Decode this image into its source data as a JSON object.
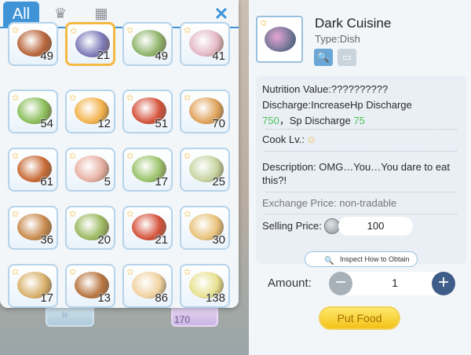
{
  "tabs": {
    "active_label": "All",
    "icons": [
      "chef-hat-icon",
      "grid-icon"
    ],
    "close_icon": "close-icon"
  },
  "inventory": [
    {
      "count": "49",
      "color": "#b8643a"
    },
    {
      "count": "21",
      "color": "#7b78b8"
    },
    {
      "count": "49",
      "color": "#8fb46a"
    },
    {
      "count": "41",
      "color": "#e3b9c6"
    },
    {
      "count": "54",
      "color": "#8bbf5b"
    },
    {
      "count": "12",
      "color": "#f3b24b"
    },
    {
      "count": "51",
      "color": "#d4523a"
    },
    {
      "count": "70",
      "color": "#e0a35c"
    },
    {
      "count": "61",
      "color": "#c86a35"
    },
    {
      "count": "5",
      "color": "#e7b0a3"
    },
    {
      "count": "17",
      "color": "#9bc36a"
    },
    {
      "count": "25",
      "color": "#c7d3a0"
    },
    {
      "count": "36",
      "color": "#c88a4e"
    },
    {
      "count": "20",
      "color": "#9ab960"
    },
    {
      "count": "21",
      "color": "#d4523a"
    },
    {
      "count": "30",
      "color": "#e8c27a"
    },
    {
      "count": "17",
      "color": "#d8b06a"
    },
    {
      "count": "13",
      "color": "#b8743e"
    },
    {
      "count": "86",
      "color": "#f1d2a0"
    },
    {
      "count": "138",
      "color": "#e7e18f"
    }
  ],
  "background": {
    "slot_count": "170"
  },
  "detail": {
    "name": "Dark Cuisine",
    "type_label": "Type:Dish",
    "nutrition": "Nutrition Value:??????????",
    "discharge_prefix": "Discharge:IncreaseHp Discharge",
    "hp_value": "750",
    "sp_text": "，Sp Discharge",
    "sp_value": "75",
    "cook_label": "Cook Lv.:",
    "description": "Description: OMG…You…You dare to eat this?!",
    "exchange": "Exchange Price: non-tradable",
    "selling_label": "Selling Price:",
    "selling_value": "100",
    "inspect_label": "Inspect How to Obtain"
  },
  "amount": {
    "label": "Amount:",
    "value": "1",
    "minus": "−",
    "plus": "+"
  },
  "put_button": "Put Food"
}
